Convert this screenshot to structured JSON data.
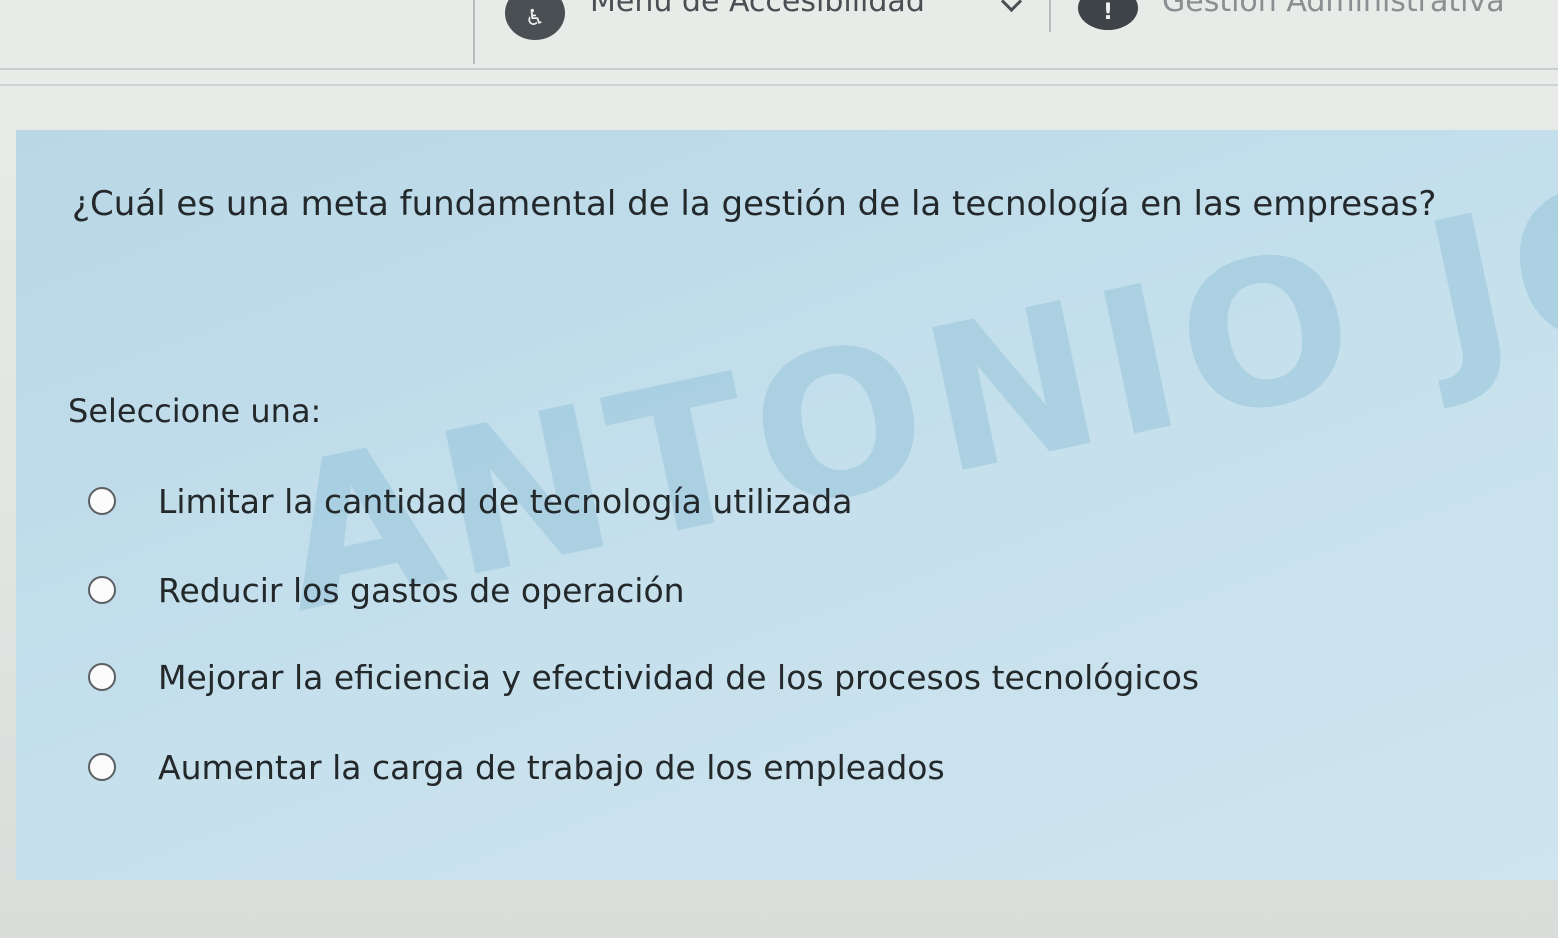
{
  "topbar": {
    "accessibility_label": "Menú de Accesibilidad",
    "admin_label": "Gestión Administrativa"
  },
  "question": {
    "text": "¿Cuál es una meta fundamental de la gestión de la tecnología en las empresas?",
    "prompt": "Seleccione una:",
    "options": [
      {
        "label": "Limitar la cantidad de tecnología utilizada"
      },
      {
        "label": "Reducir los gastos de operación"
      },
      {
        "label": "Mejorar la eficiencia y efectividad de los procesos tecnológicos"
      },
      {
        "label": "Aumentar la carga de trabajo de los empleados"
      }
    ]
  },
  "watermark": {
    "text": "ANTONIO JOSE V"
  }
}
